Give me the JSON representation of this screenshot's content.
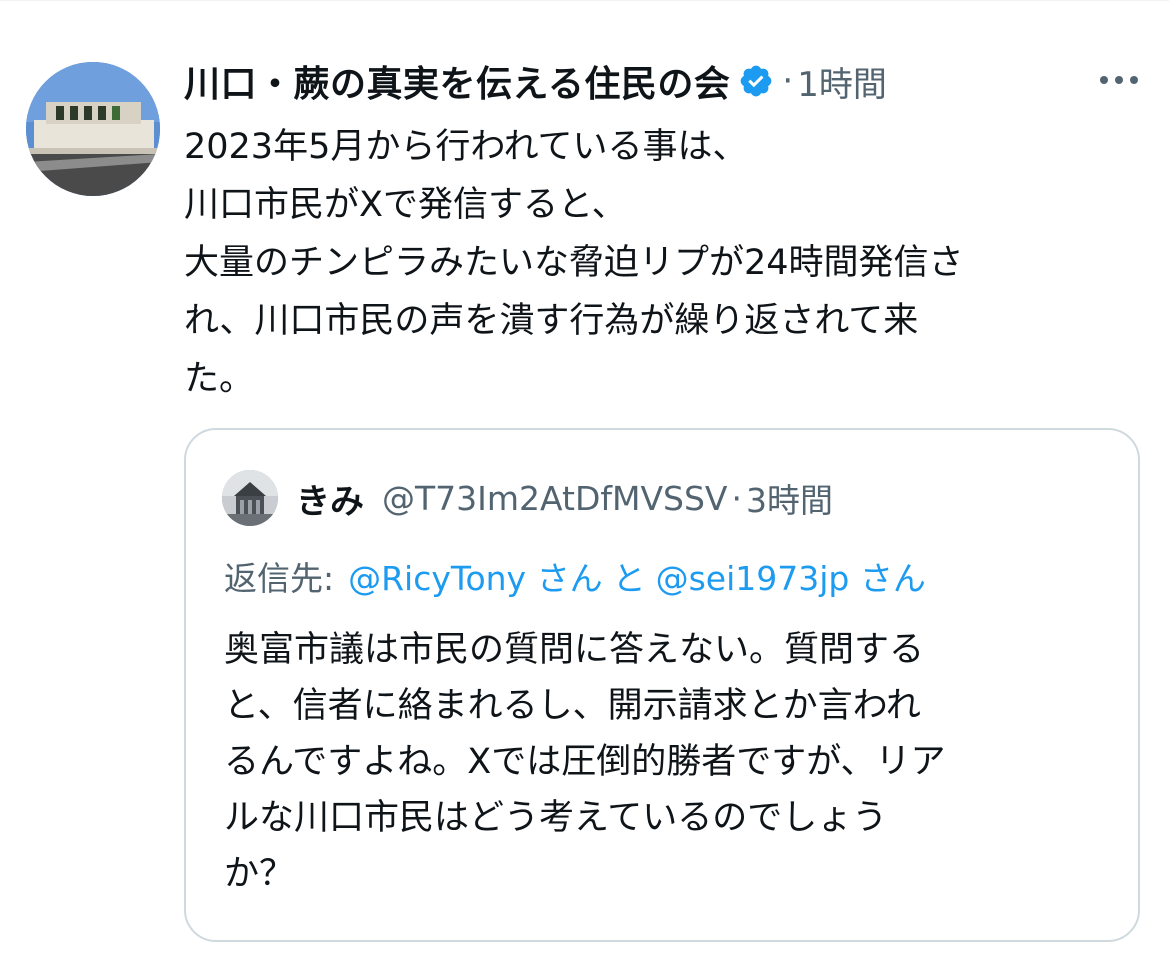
{
  "tweet": {
    "display_name": "川口・蕨の真実を伝える住民の会",
    "separator": "·",
    "time": "1時間",
    "text_lines": [
      "2023年5月から行われている事は、",
      "川口市民がXで発信すると、",
      "大量のチンピラみたいな脅迫リプが24時間発信さ",
      "れ、川口市民の声を潰す行為が繰り返されて来",
      "た。"
    ],
    "icons": {
      "verified": "verified-badge-icon",
      "more": "more-options-icon"
    }
  },
  "quote": {
    "display_name": "きみ",
    "handle": "@T73Im2AtDfMVSSV",
    "separator": "·",
    "time": "3時間",
    "reply_prefix": "返信先:",
    "reply_mentions": [
      "@RicyTony さん",
      "@sei1973jp さん"
    ],
    "reply_joiner": "と",
    "text_lines": [
      "奥富市議は市民の質問に答えない。質問する",
      "と、信者に絡まれるし、開示請求とか言われ",
      "るんですよね。Xでは圧倒的勝者ですが、リア",
      "ルな川口市民はどう考えているのでしょう",
      "か？"
    ]
  },
  "colors": {
    "text": "#0f1419",
    "secondary": "#536471",
    "link": "#1d9bf0",
    "verified": "#1d9bf0",
    "border": "#cfd9de"
  }
}
